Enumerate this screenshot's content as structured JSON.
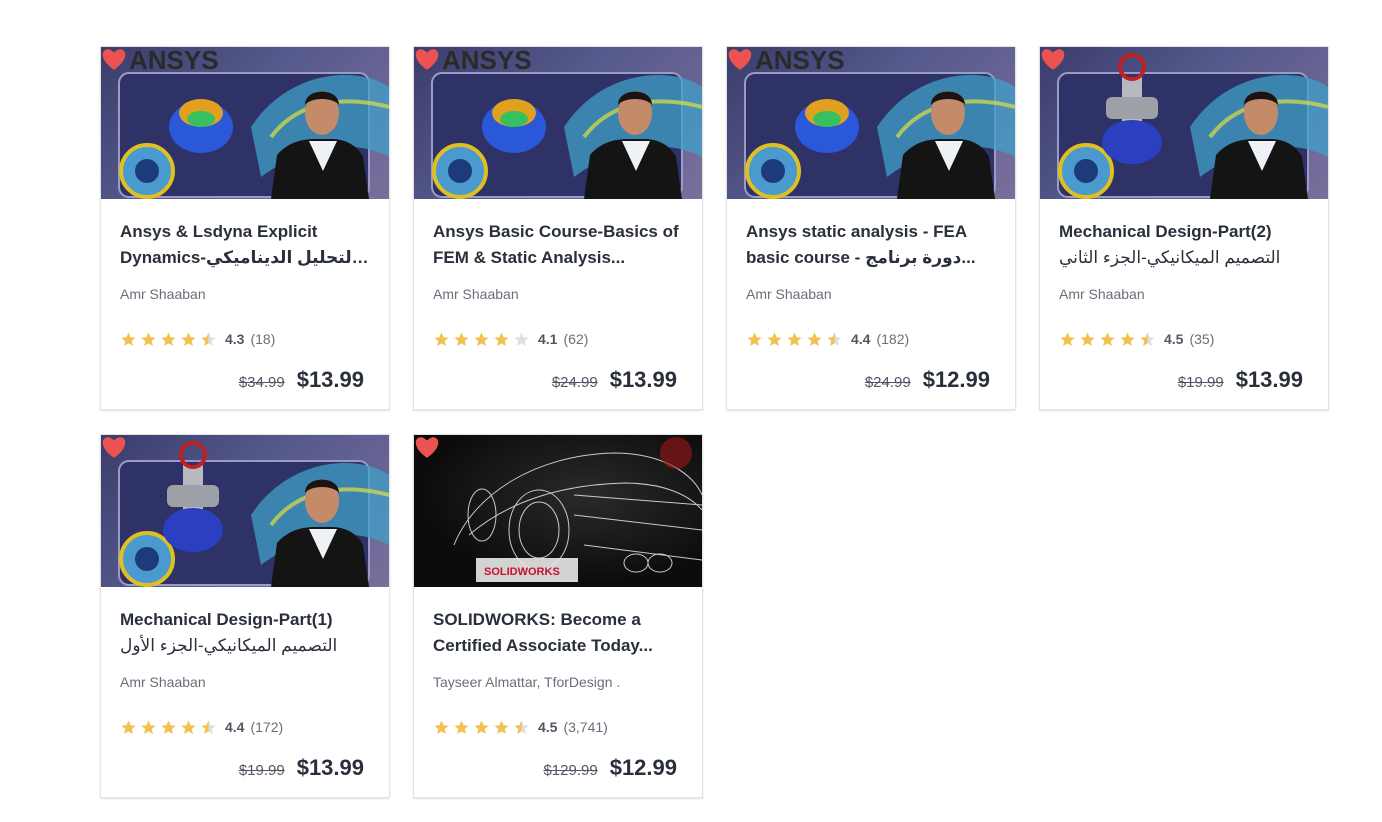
{
  "colors": {
    "star": "#f4c150",
    "star_empty": "#dedfe0",
    "heart": "#ec5252"
  },
  "cards": [
    {
      "thumb_brand": "ANSYS",
      "thumb_style": "ansys",
      "title_line1": "Ansys & Lsdyna Explicit",
      "title_line2": "Dynamics-التحليل الديناميكي...",
      "author": "Amr Shaaban",
      "rating": "4.3",
      "rating_value": 4.3,
      "reviews": "(18)",
      "old_price": "$34.99",
      "price": "$13.99"
    },
    {
      "thumb_brand": "ANSYS",
      "thumb_style": "ansys",
      "title_line1": "Ansys Basic Course-Basics of",
      "title_line2": "FEM & Static Analysis...",
      "author": "Amr Shaaban",
      "rating": "4.1",
      "rating_value": 4.1,
      "reviews": "(62)",
      "old_price": "$24.99",
      "price": "$13.99"
    },
    {
      "thumb_brand": "ANSYS",
      "thumb_style": "ansys",
      "title_line1": "Ansys static analysis - FEA",
      "title_line2": "basic course - دورة برنامج...",
      "author": "Amr Shaaban",
      "rating": "4.4",
      "rating_value": 4.4,
      "reviews": "(182)",
      "old_price": "$24.99",
      "price": "$12.99"
    },
    {
      "thumb_brand": "",
      "thumb_style": "mech",
      "title_line1": "Mechanical Design-Part(2)",
      "title_line2": "التصميم الميكانيكي-الجزء الثاني",
      "author": "Amr Shaaban",
      "rating": "4.5",
      "rating_value": 4.5,
      "reviews": "(35)",
      "old_price": "$19.99",
      "price": "$13.99"
    },
    {
      "thumb_brand": "",
      "thumb_style": "mech",
      "title_line1": "Mechanical Design-Part(1)",
      "title_line2": "التصميم الميكانيكي-الجزء الأول",
      "author": "Amr Shaaban",
      "rating": "4.4",
      "rating_value": 4.4,
      "reviews": "(172)",
      "old_price": "$19.99",
      "price": "$13.99"
    },
    {
      "thumb_brand": "SOLIDWORKS",
      "thumb_style": "car",
      "title_line1": "SOLIDWORKS: Become a",
      "title_line2": "Certified Associate Today...",
      "author": "Tayseer Almattar, TforDesign .",
      "rating": "4.5",
      "rating_value": 4.5,
      "reviews": "(3,741)",
      "old_price": "$129.99",
      "price": "$12.99"
    }
  ]
}
